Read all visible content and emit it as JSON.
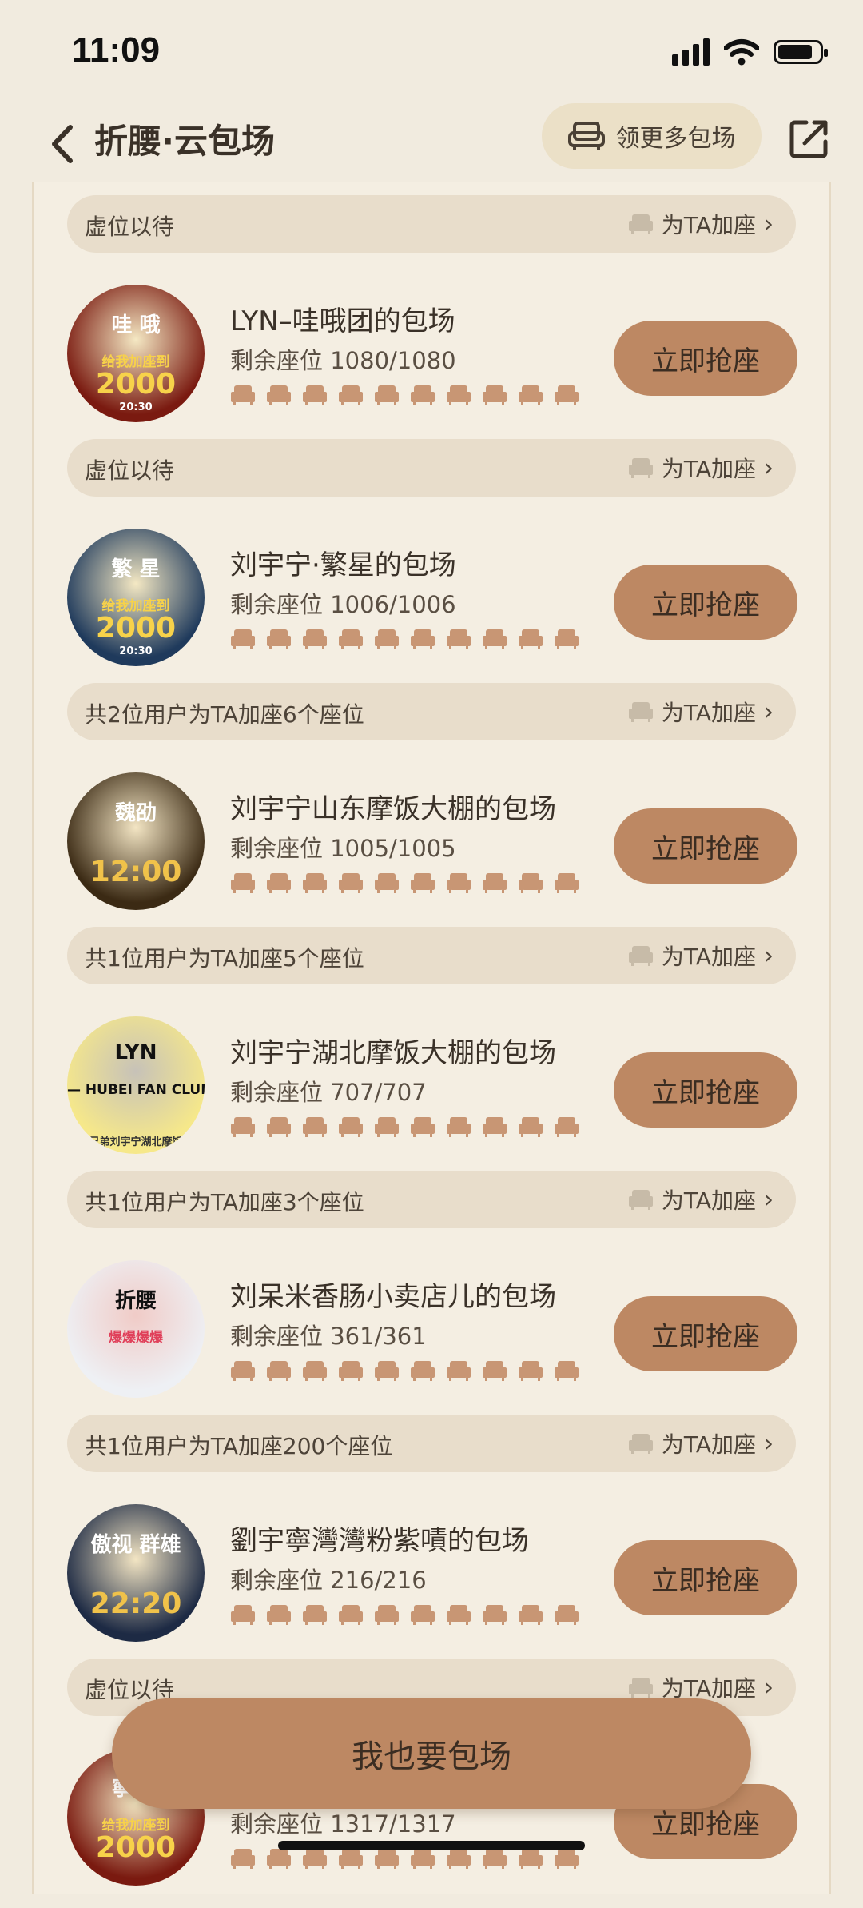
{
  "status": {
    "time": "11:09"
  },
  "nav": {
    "title": "折腰·云包场",
    "claim_more": "领更多包场"
  },
  "support_default": {
    "add_label": "为TA加座"
  },
  "top_support": {
    "text": "虚位以待"
  },
  "entries": [
    {
      "title": "LYN–哇哦团的包场",
      "seats": "剩余座位 1080/1080",
      "button": "立即抢座",
      "avatar": {
        "top_text": "哇  哦",
        "banner": "给我加座到",
        "big": "2000",
        "small": "20:30",
        "bg": "#7a1a10",
        "accent": "#f7d24a"
      },
      "support": "虚位以待"
    },
    {
      "title": "刘宇宁·繁星的包场",
      "seats": "剩余座位 1006/1006",
      "button": "立即抢座",
      "avatar": {
        "top_text": "繁  星",
        "banner": "给我加座到",
        "big": "2000",
        "small": "20:30",
        "bg": "#1f3a5c",
        "accent": "#f7d24a"
      },
      "support": "共2位用户为TA加座6个座位"
    },
    {
      "title": "刘宇宁山东摩饭大棚的包场",
      "seats": "剩余座位 1005/1005",
      "button": "立即抢座",
      "avatar": {
        "top_text": "魏劭",
        "banner": "",
        "big": "12:00",
        "small": "",
        "bg": "#3b2a14",
        "accent": "#f0c24a"
      },
      "support": "共1位用户为TA加座5个座位"
    },
    {
      "title": "刘宇宁湖北摩饭大棚的包场",
      "seats": "剩余座位 707/707",
      "button": "立即抢座",
      "avatar": {
        "top_text": "LYN",
        "banner": "— HUBEI FAN CLUB —",
        "big": "",
        "small": "摩登兄弟刘宇宁湖北摩饭大棚",
        "bg": "#f6e88a",
        "accent": "#111111"
      },
      "support": "共1位用户为TA加座3个座位"
    },
    {
      "title": "刘呆米香肠小卖店儿的包场",
      "seats": "剩余座位 361/361",
      "button": "立即抢座",
      "avatar": {
        "top_text": "折腰",
        "banner": "爆爆爆爆",
        "big": "",
        "small": "",
        "bg": "#eef0f4",
        "accent": "#e0405a"
      },
      "support": "共1位用户为TA加座200个座位"
    },
    {
      "title": "劉宇寧灣灣粉紫嘖的包场",
      "seats": "剩余座位 216/216",
      "button": "立即抢座",
      "avatar": {
        "top_text": "傲视  群雄",
        "banner": "",
        "big": "22:20",
        "small": "",
        "bg": "#1d2a44",
        "accent": "#f0c24a"
      },
      "support": "虚位以待"
    },
    {
      "title": "",
      "seats": "剩余座位 1317/1317",
      "button": "立即抢座",
      "avatar": {
        "top_text": "寧  天",
        "banner": "给我加座到",
        "big": "2000",
        "small": "",
        "bg": "#7a1a10",
        "accent": "#f7d24a"
      },
      "support": ""
    }
  ],
  "footer": {
    "button": "我也要包场"
  },
  "colors": {
    "accent": "#bd8863",
    "bg": "#f1ebdf",
    "pill": "#e8ddcb",
    "seat": "#c89674"
  }
}
